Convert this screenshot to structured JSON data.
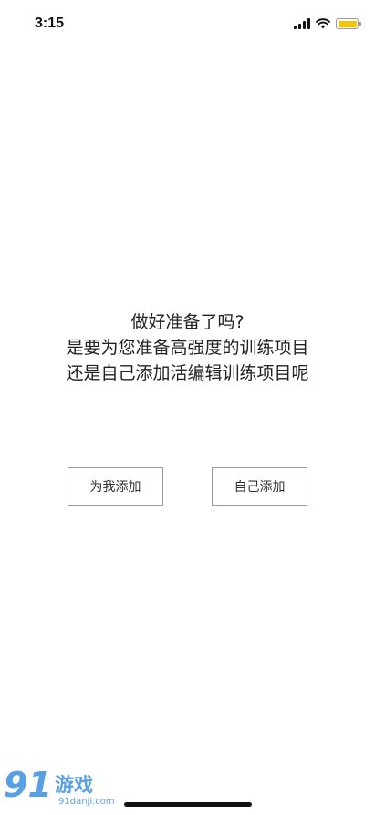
{
  "status_bar": {
    "time": "3:15",
    "signal_icon": "cellular-signal-icon",
    "wifi_icon": "wifi-icon",
    "battery_icon": "battery-icon",
    "battery_color": "#f5c400"
  },
  "prompt": {
    "line1": "做好准备了吗?",
    "line2": "是要为您准备高强度的训练项目",
    "line3": "还是自己添加活编辑训练项目呢"
  },
  "buttons": {
    "auto_add_label": "为我添加",
    "self_add_label": "自己添加"
  },
  "watermark": {
    "logo_text": "91游戏",
    "site_text": "91danji.com"
  }
}
